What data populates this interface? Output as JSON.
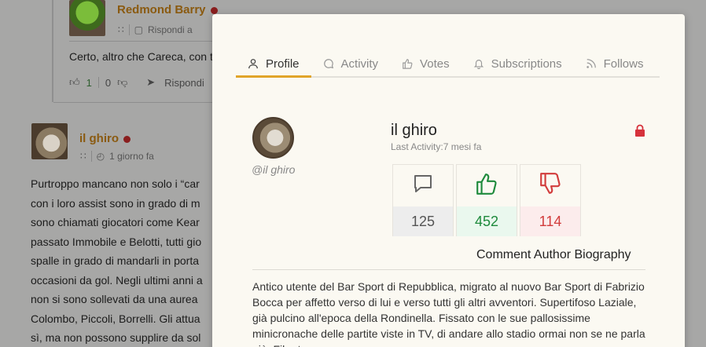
{
  "background": {
    "comment1": {
      "author": "Redmond Barry",
      "reply_label": "Rispondi a",
      "text": "Certo, altro che Careca, con t",
      "upvotes": "1",
      "downvotes": "0",
      "reply_button": "Rispondi"
    },
    "comment2": {
      "author": "il ghiro",
      "time": "1 giorno fa",
      "body_lines": [
        "Purtroppo mancano non solo i “car",
        "con i loro assist sono in grado di m",
        "sono chiamati giocatori come Kear",
        "passato Immobile e Belotti, tutti gio",
        "spalle in grado di mandarli in porta",
        "occasioni da gol. Negli ultimi anni a",
        "non si sono sollevati da una aurea",
        "Colombo, Piccoli, Borrelli. Gli attua",
        "sì, ma non possono supplire da sol"
      ]
    }
  },
  "modal": {
    "tabs": [
      {
        "label": "Profile",
        "icon": "user-icon",
        "active": true
      },
      {
        "label": "Activity",
        "icon": "chat-icon",
        "active": false
      },
      {
        "label": "Votes",
        "icon": "thumbs-up-icon",
        "active": false
      },
      {
        "label": "Subscriptions",
        "icon": "bell-icon",
        "active": false
      },
      {
        "label": "Follows",
        "icon": "rss-icon",
        "active": false
      }
    ],
    "profile": {
      "name": "il ghiro",
      "handle": "@il ghiro",
      "last_activity": "Last Activity:7 mesi fa"
    },
    "stats": {
      "comments": "125",
      "upvotes": "452",
      "downvotes": "114"
    },
    "bio": {
      "title": "Comment Author Biography",
      "text": "Antico utente del Bar Sport di Repubblica, migrato al nuovo Bar Sport di Fabrizio Bocca per affetto verso di lui e verso tutti gli altri avventori. Supertifoso Laziale, già pulcino all'epoca della Rondinella. Fissato con le sue pallosissime minicronache delle partite viste in TV, di andare allo stadio ormai non se ne parla più. Fibe tener pena."
    },
    "colors": {
      "accent": "#e1a52a",
      "upvote": "#1e8a3c",
      "downvote": "#d23c3c",
      "lock": "#d6323c"
    }
  }
}
